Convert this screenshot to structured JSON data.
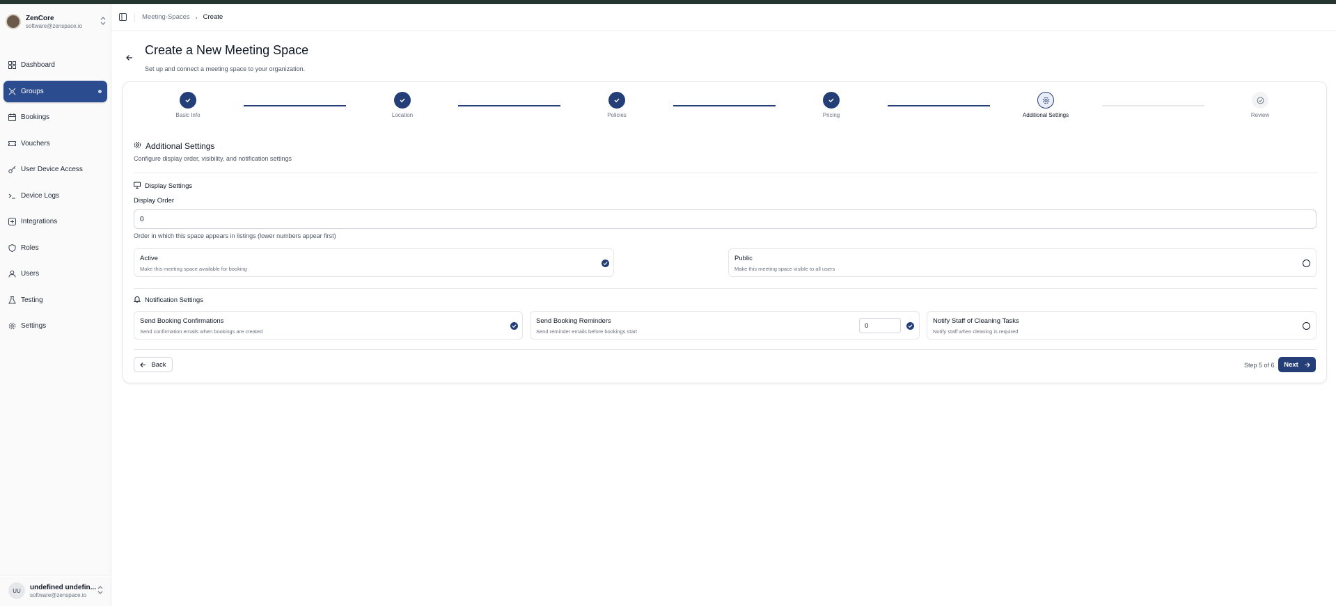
{
  "org": {
    "name": "ZenCore",
    "email": "software@zenspace.io"
  },
  "sidebar": {
    "items": [
      {
        "label": "Dashboard",
        "icon": "dashboard-icon"
      },
      {
        "label": "Groups",
        "icon": "groups-icon",
        "active": true
      },
      {
        "label": "Bookings",
        "icon": "calendar-icon"
      },
      {
        "label": "Vouchers",
        "icon": "ticket-icon"
      },
      {
        "label": "User Device Access",
        "icon": "key-icon"
      },
      {
        "label": "Device Logs",
        "icon": "terminal-icon"
      },
      {
        "label": "Integrations",
        "icon": "integrations-icon"
      },
      {
        "label": "Roles",
        "icon": "shield-icon"
      },
      {
        "label": "Users",
        "icon": "users-icon"
      },
      {
        "label": "Testing",
        "icon": "flask-icon"
      },
      {
        "label": "Settings",
        "icon": "gear-icon"
      }
    ]
  },
  "user": {
    "initials": "UU",
    "name": "undefined undefin...",
    "email": "software@zenspace.io"
  },
  "breadcrumb": {
    "parent": "Meeting-Spaces",
    "current": "Create"
  },
  "page": {
    "title": "Create a New Meeting Space",
    "subtitle": "Set up and connect a meeting space to your organization."
  },
  "stepper": {
    "steps": [
      {
        "label": "Basic Info",
        "state": "done"
      },
      {
        "label": "Location",
        "state": "done"
      },
      {
        "label": "Policies",
        "state": "done"
      },
      {
        "label": "Pricing",
        "state": "done"
      },
      {
        "label": "Additional Settings",
        "state": "current"
      },
      {
        "label": "Review",
        "state": "todo"
      }
    ]
  },
  "section": {
    "title": "Additional Settings",
    "description": "Configure display order, visibility, and notification settings"
  },
  "display": {
    "heading": "Display Settings",
    "order_label": "Display Order",
    "order_value": "0",
    "order_help": "Order in which this space appears in listings (lower numbers appear first)",
    "active": {
      "title": "Active",
      "desc": "Make this meeting space available for booking",
      "checked": true
    },
    "public": {
      "title": "Public",
      "desc": "Make this meeting space visible to all users",
      "checked": false
    }
  },
  "notifications": {
    "heading": "Notification Settings",
    "confirmations": {
      "title": "Send Booking Confirmations",
      "desc": "Send confirmation emails when bookings are created",
      "checked": true
    },
    "reminders": {
      "title": "Send Booking Reminders",
      "desc": "Send reminder emails before bookings start",
      "value": "0",
      "checked": true
    },
    "cleaning": {
      "title": "Notify Staff of Cleaning Tasks",
      "desc": "Notify staff when cleaning is required",
      "checked": false
    }
  },
  "footer": {
    "back": "Back",
    "step_text": "Step 5 of 6",
    "next": "Next"
  },
  "colors": {
    "primary": "#243f78",
    "active_nav": "#2b4c8f",
    "topbar": "#24362f"
  }
}
